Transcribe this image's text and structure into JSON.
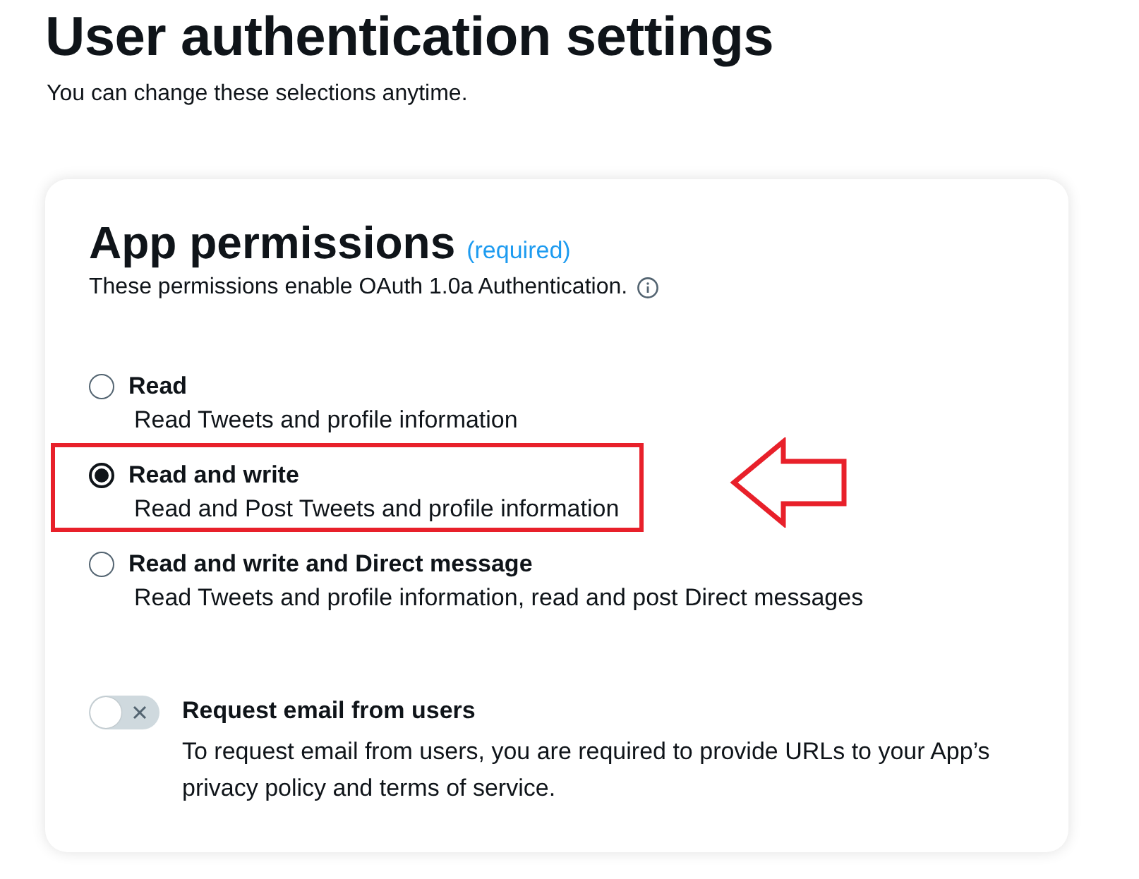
{
  "page": {
    "title": "User authentication settings",
    "subtitle": "You can change these selections anytime."
  },
  "app_permissions": {
    "title": "App permissions",
    "required_note": "(required)",
    "description": "These permissions enable OAuth 1.0a Authentication.",
    "options": [
      {
        "label": "Read",
        "description": "Read Tweets and profile information",
        "selected": false,
        "highlighted": false
      },
      {
        "label": "Read and write",
        "description": "Read and Post Tweets and profile information",
        "selected": true,
        "highlighted": true
      },
      {
        "label": "Read and write and Direct message",
        "description": "Read Tweets and profile information, read and post Direct messages",
        "selected": false,
        "highlighted": false
      }
    ],
    "email_toggle": {
      "label": "Request email from users",
      "description": "To request email from users, you are required to provide URLs to your App’s privacy policy and terms of service.",
      "on": false
    }
  }
}
